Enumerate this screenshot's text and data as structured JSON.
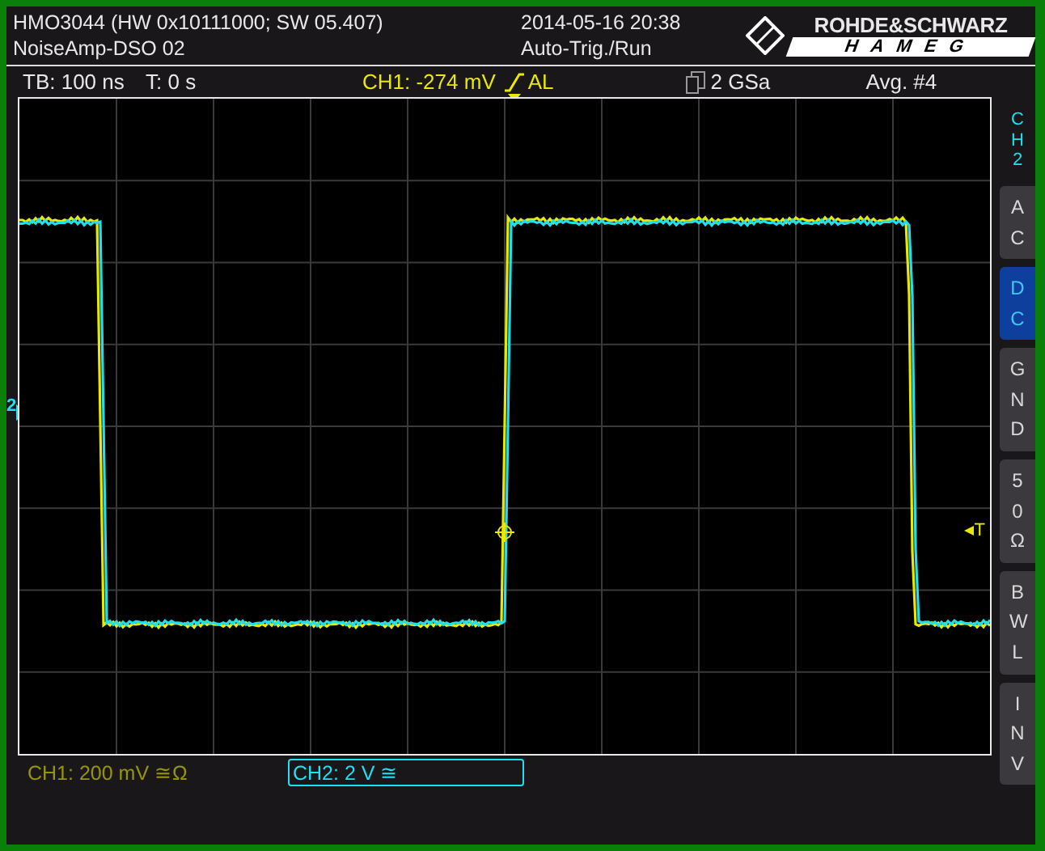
{
  "header": {
    "device": "HMO3044 (HW 0x10111000; SW 05.407)",
    "setup": "NoiseAmp-DSO 02",
    "datetime": "2014-05-16 20:38",
    "mode": "Auto-Trig./Run",
    "brand": "ROHDE&SCHWARZ",
    "sub_brand": "HAMEG"
  },
  "info_bar": {
    "timebase": "TB: 100 ns",
    "trigger_time": "T: 0 s",
    "trigger_level": "CH1: -274 mV",
    "trigger_coupling": "AL",
    "sample_rate": "2 GSa",
    "average": "Avg. #4"
  },
  "markers": {
    "channel_marker": "2",
    "trigger_marker": "T"
  },
  "side_panel": {
    "channel": "CH2",
    "buttons": [
      {
        "label": "AC",
        "selected": false
      },
      {
        "label": "DC",
        "selected": true
      },
      {
        "label": "GND",
        "selected": false
      },
      {
        "label": "50Ω",
        "selected": false
      },
      {
        "label": "BWL",
        "selected": false
      },
      {
        "label": "INV",
        "selected": false
      }
    ]
  },
  "channels": [
    {
      "label": "CH1: 200 mV ≅Ω",
      "selected": false,
      "color": "#e8e800"
    },
    {
      "label": "CH2: 2 V ≅",
      "selected": true,
      "color": "#20e0f0"
    }
  ]
}
